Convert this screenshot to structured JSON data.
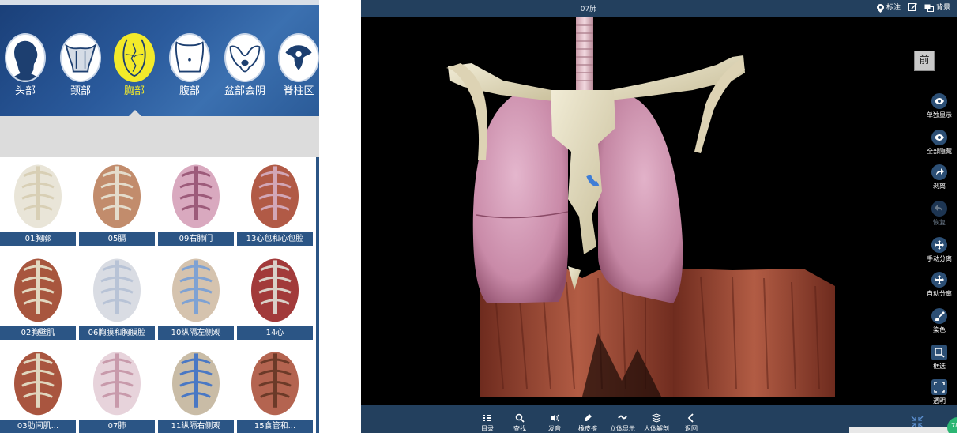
{
  "regions": [
    {
      "label": "头部",
      "icon": "head-icon",
      "active": false
    },
    {
      "label": "颈部",
      "icon": "neck-icon",
      "active": false
    },
    {
      "label": "胸部",
      "icon": "chest-icon",
      "active": true
    },
    {
      "label": "腹部",
      "icon": "abdomen-icon",
      "active": false
    },
    {
      "label": "盆部会阴",
      "icon": "pelvis-icon",
      "active": false
    },
    {
      "label": "脊柱区",
      "icon": "spine-icon",
      "active": false
    }
  ],
  "models": [
    {
      "label": "01胸廓"
    },
    {
      "label": "05膈"
    },
    {
      "label": "09右肺门"
    },
    {
      "label": "13心包和心包腔"
    },
    {
      "label": "02胸壁肌"
    },
    {
      "label": "06胸膜和胸膜腔"
    },
    {
      "label": "10纵隔左侧观"
    },
    {
      "label": "14心"
    },
    {
      "label": "03肋间肌..."
    },
    {
      "label": "07肺"
    },
    {
      "label": "11纵隔右侧观"
    },
    {
      "label": "15食管和..."
    }
  ],
  "viewer": {
    "title": "07肺",
    "top_tools": [
      {
        "label": "标注",
        "icon": "location-pin-icon"
      },
      {
        "label": "",
        "icon": "edit-icon"
      },
      {
        "label": "背景",
        "icon": "background-icon"
      }
    ],
    "view_direction": "前",
    "right_tools": [
      {
        "label": "单独显示",
        "icon": "eye-icon",
        "enabled": true
      },
      {
        "label": "全部隐藏",
        "icon": "eye-icon",
        "enabled": true
      },
      {
        "label": "剥离",
        "icon": "redo-arrow-icon",
        "enabled": true
      },
      {
        "label": "恢复",
        "icon": "undo-arrow-icon",
        "enabled": false
      },
      {
        "label": "手动分离",
        "icon": "move-arrows-icon",
        "enabled": true
      },
      {
        "label": "自动分离",
        "icon": "expand-arrows-icon",
        "enabled": true
      },
      {
        "label": "染色",
        "icon": "brush-icon",
        "enabled": true
      },
      {
        "label": "框选",
        "icon": "box-select-icon",
        "enabled": true
      },
      {
        "label": "透明",
        "icon": "transparent-icon",
        "enabled": true
      }
    ],
    "bottom_tools": [
      {
        "label": "目录",
        "icon": "list-icon"
      },
      {
        "label": "查找",
        "icon": "search-icon"
      },
      {
        "label": "发音",
        "icon": "speaker-icon"
      },
      {
        "label": "橡皮擦",
        "icon": "eraser-icon"
      },
      {
        "label": "立体显示",
        "icon": "stereo-icon"
      },
      {
        "label": "人体解剖",
        "icon": "layers-icon"
      },
      {
        "label": "返回",
        "icon": "chevron-left-icon"
      }
    ],
    "badge": "78"
  },
  "colors": {
    "active_region": "#f3ea2a",
    "caption_bar": "#2b5585",
    "toolbar_bg": "#23405e"
  }
}
